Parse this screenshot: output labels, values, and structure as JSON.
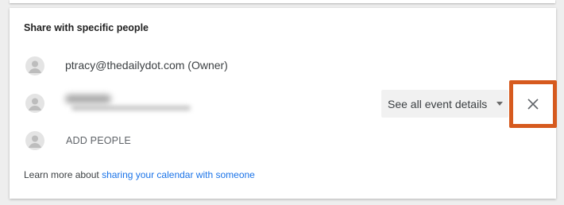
{
  "section": {
    "title": "Share with specific people"
  },
  "people": [
    {
      "label": "ptracy@thedailydot.com (Owner)"
    }
  ],
  "permission": {
    "selected": "See all event details"
  },
  "add_people_label": "ADD PEOPLE",
  "footer": {
    "prefix": "Learn more about ",
    "link_text": "sharing your calendar with someone"
  },
  "colors": {
    "highlight": "#d65a1e",
    "link": "#1a73e8"
  }
}
